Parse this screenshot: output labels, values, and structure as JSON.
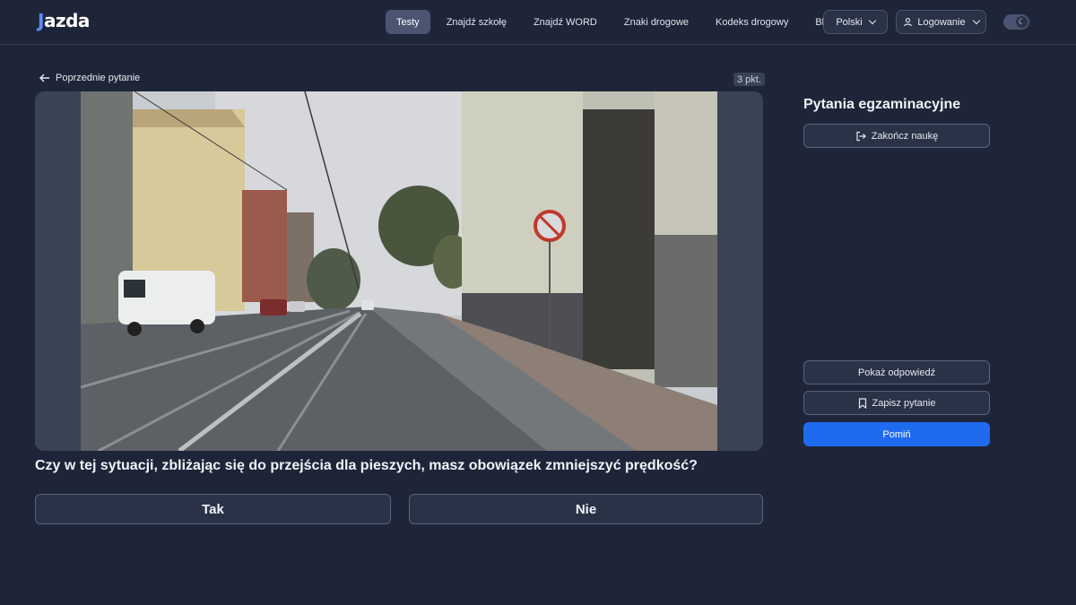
{
  "header": {
    "logo": "jazda",
    "nav": [
      "Testy",
      "Znajdź szkołę",
      "Znajdź WORD",
      "Znaki drogowe",
      "Kodeks drogowy",
      "Blog"
    ],
    "active_nav": "Testy",
    "language": "Polski",
    "login": "Logowanie",
    "theme_icon": "moon-icon"
  },
  "question_panel": {
    "back_label": "Poprzednie pytanie",
    "points": "3 pkt.",
    "question": "Czy w tej sytuacji, zbliżając się do przejścia dla pieszych, masz obowiązek zmniejszyć prędkość?",
    "answers": [
      "Tak",
      "Nie"
    ]
  },
  "sidebar": {
    "title": "Pytania egzaminacyjne",
    "end_label": "Zakończ naukę",
    "show_answer_label": "Pokaż odpowiedź",
    "save_label": "Zapisz pytanie",
    "skip_label": "Pomiń"
  },
  "colors": {
    "background": "#1e2538",
    "accent": "#1f6bf0",
    "active_nav": "#4b5470"
  }
}
